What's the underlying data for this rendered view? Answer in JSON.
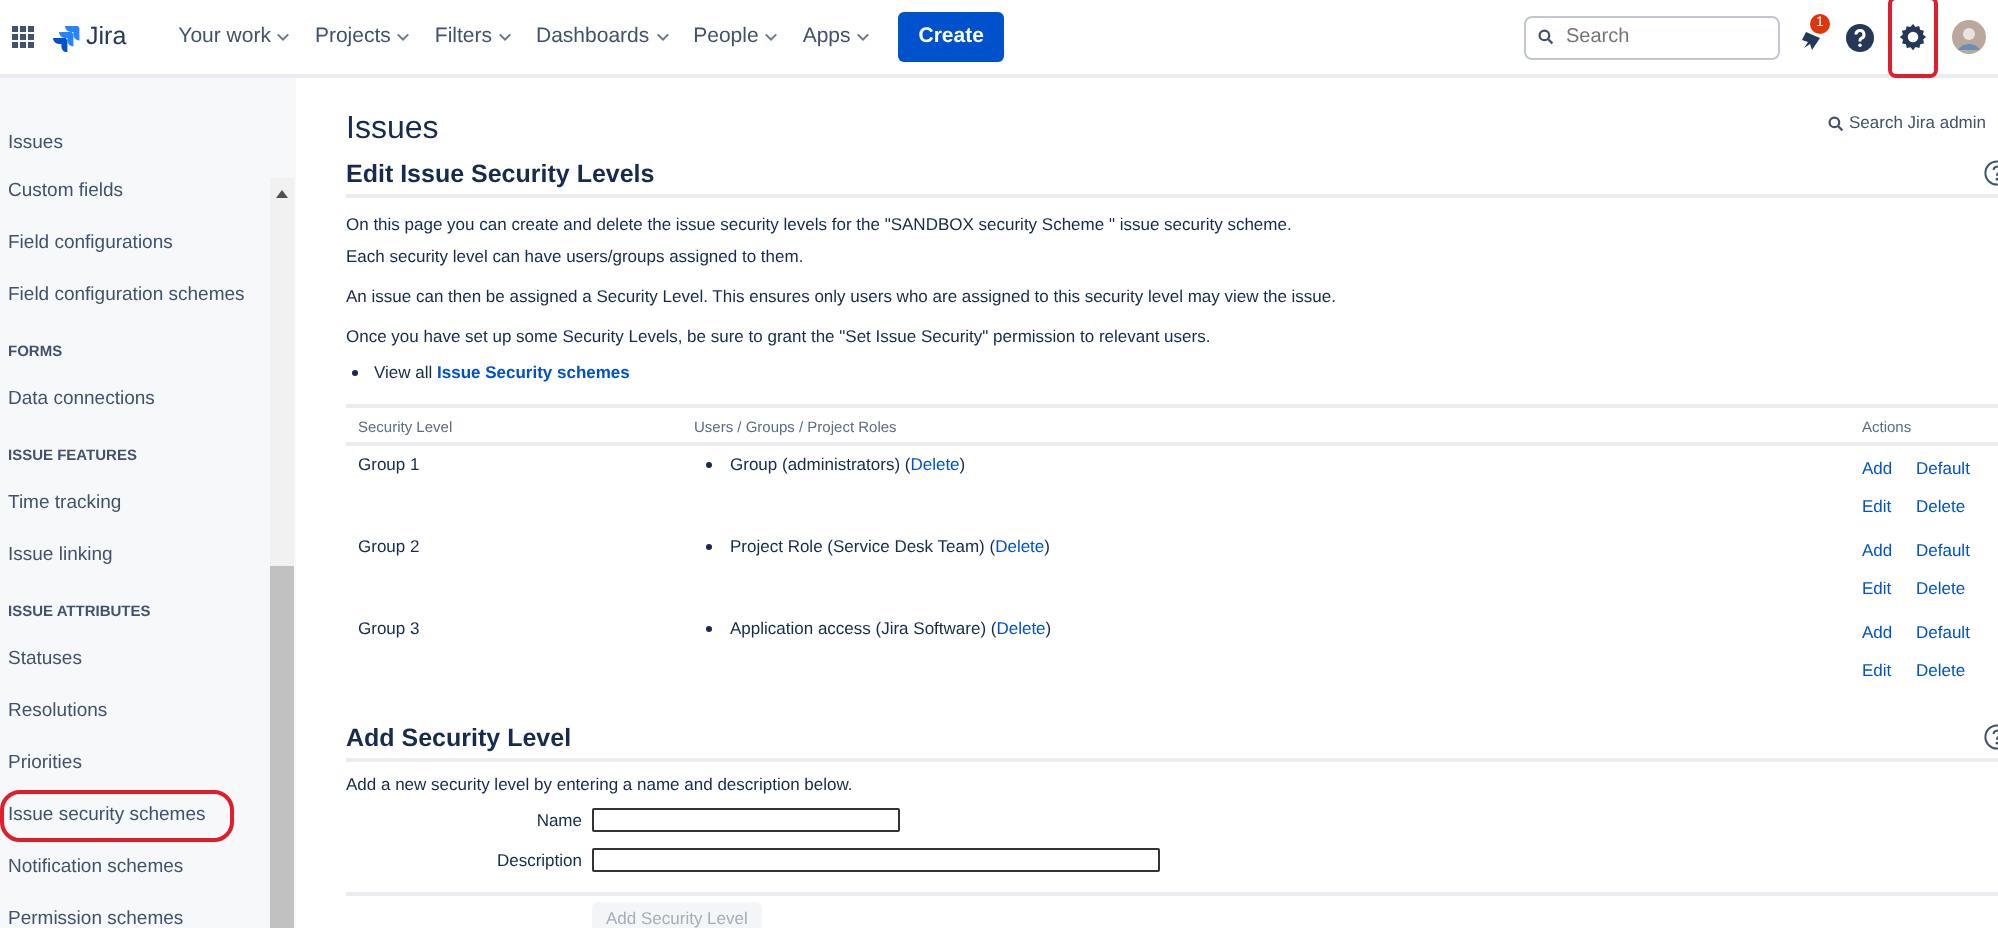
{
  "header": {
    "logo": "Jira",
    "nav": [
      {
        "label": "Your work"
      },
      {
        "label": "Projects"
      },
      {
        "label": "Filters"
      },
      {
        "label": "Dashboards"
      },
      {
        "label": "People"
      },
      {
        "label": "Apps"
      }
    ],
    "create": "Create",
    "search": {
      "placeholder": "Search"
    },
    "notifications": {
      "count": "1"
    },
    "settings": {
      "highlighted": true
    }
  },
  "sidebar": {
    "title": "Issues",
    "items": [
      {
        "kind": "item",
        "label": "Custom fields",
        "highlighted": false
      },
      {
        "kind": "item",
        "label": "Field configurations",
        "highlighted": false
      },
      {
        "kind": "item",
        "label": "Field configuration schemes",
        "highlighted": false
      },
      {
        "kind": "heading",
        "label": "FORMS"
      },
      {
        "kind": "item",
        "label": "Data connections",
        "highlighted": false
      },
      {
        "kind": "heading",
        "label": "ISSUE FEATURES"
      },
      {
        "kind": "item",
        "label": "Time tracking",
        "highlighted": false
      },
      {
        "kind": "item",
        "label": "Issue linking",
        "highlighted": false
      },
      {
        "kind": "heading",
        "label": "ISSUE ATTRIBUTES"
      },
      {
        "kind": "item",
        "label": "Statuses",
        "highlighted": false
      },
      {
        "kind": "item",
        "label": "Resolutions",
        "highlighted": false
      },
      {
        "kind": "item",
        "label": "Priorities",
        "highlighted": false
      },
      {
        "kind": "item",
        "label": "Issue security schemes",
        "highlighted": true
      },
      {
        "kind": "item",
        "label": "Notification schemes",
        "highlighted": false
      },
      {
        "kind": "item",
        "label": "Permission schemes",
        "highlighted": false
      }
    ]
  },
  "main": {
    "title": "Issues",
    "admin_search": "Search Jira admin",
    "edit_section": {
      "heading": "Edit Issue Security Levels",
      "paragraphs": [
        [
          "On this page you can create and delete the issue security levels for the \"SANDBOX security Scheme \" issue security scheme.",
          "Each security level can have users/groups assigned to them."
        ],
        [
          "An issue can then be assigned a Security Level. This ensures only users who are assigned to this security level may view the issue."
        ],
        [
          "Once you have set up some Security Levels, be sure to grant the \"Set Issue Security\" permission to relevant users."
        ]
      ],
      "view_all": {
        "text": "View all",
        "link": "Issue Security schemes"
      }
    },
    "table": {
      "columns": [
        "Security Level",
        "Users / Groups / Project Roles",
        "Actions"
      ],
      "rows": [
        {
          "level": "Group 1",
          "member": {
            "text": "Group (administrators) (",
            "link": "Delete",
            "close": ")"
          },
          "actions": [
            "Add",
            "Default",
            "Edit",
            "Delete"
          ]
        },
        {
          "level": "Group 2",
          "member": {
            "text": "Project Role (Service Desk Team) (",
            "link": "Delete",
            "close": ")"
          },
          "actions": [
            "Add",
            "Default",
            "Edit",
            "Delete"
          ]
        },
        {
          "level": "Group 3",
          "member": {
            "text": "Application access (Jira Software) (",
            "link": "Delete",
            "close": ")"
          },
          "actions": [
            "Add",
            "Default",
            "Edit",
            "Delete"
          ]
        }
      ]
    },
    "add_section": {
      "heading": "Add Security Level",
      "description": "Add a new security level by entering a name and description below.",
      "fields": [
        {
          "label": "Name",
          "kind": "short"
        },
        {
          "label": "Description",
          "kind": "long"
        }
      ],
      "button": {
        "label": "Add Security Level",
        "disabled": true
      }
    }
  }
}
